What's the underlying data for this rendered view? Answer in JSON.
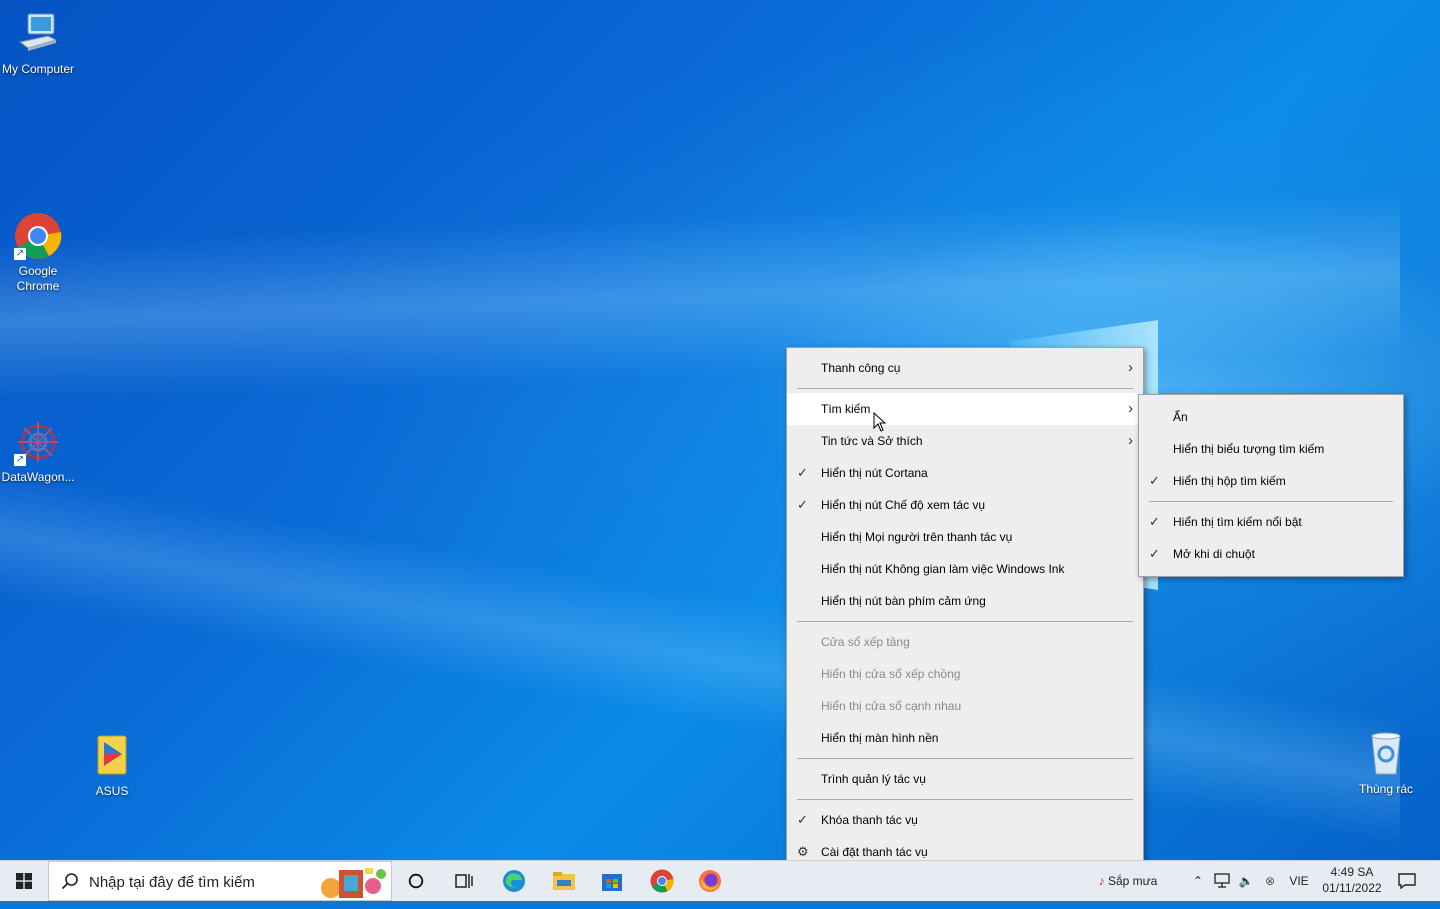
{
  "desktop": {
    "icons": [
      {
        "label": "My Computer",
        "icon": "computer-icon"
      },
      {
        "label": "Google Chrome",
        "icon": "chrome-icon"
      },
      {
        "label": "DataWagon...",
        "icon": "datawagon-icon"
      },
      {
        "label": "ASUS",
        "icon": "asus-folder-icon"
      },
      {
        "label": "Thùng rác",
        "icon": "recycle-bin-icon"
      }
    ]
  },
  "context_menu": {
    "items": [
      {
        "label": "Thanh công cụ",
        "submenu": true
      },
      {
        "label": "Tìm kiếm",
        "submenu": true,
        "highlighted": true
      },
      {
        "label": "Tin tức và Sở thích",
        "submenu": true
      },
      {
        "label": "Hiển thị nút Cortana",
        "checked": true
      },
      {
        "label": "Hiển thị nút Chế độ xem tác vụ",
        "checked": true
      },
      {
        "label": "Hiển thị Mọi người trên thanh tác vụ"
      },
      {
        "label": "Hiển thị nút Không gian làm việc Windows Ink"
      },
      {
        "label": "Hiển thị nút bàn phím cảm ứng"
      },
      {
        "label": "Cửa sổ xếp tầng",
        "disabled": true
      },
      {
        "label": "Hiển thị cửa sổ xếp chồng",
        "disabled": true
      },
      {
        "label": "Hiển thị cửa sổ cạnh nhau",
        "disabled": true
      },
      {
        "label": "Hiển thị màn hình nền"
      },
      {
        "label": "Trình quản lý tác vụ"
      },
      {
        "label": "Khóa thanh tác vụ",
        "checked": true
      },
      {
        "label": "Cài đặt thanh tác vụ",
        "icon": "gear-icon"
      }
    ]
  },
  "search_submenu": {
    "items": [
      {
        "label": "Ẩn"
      },
      {
        "label": "Hiển thị biểu tượng tìm kiếm"
      },
      {
        "label": "Hiển thị hộp tìm kiếm",
        "checked": true
      },
      {
        "label": "Hiển thị tìm kiếm nổi bật",
        "checked": true
      },
      {
        "label": "Mở khi di chuột",
        "checked": true
      }
    ]
  },
  "taskbar": {
    "search_placeholder": "Nhập tại đây để tìm kiếm",
    "weather_text": "Sắp mưa",
    "language": "VIE",
    "time": "4:49 SA",
    "date": "01/11/2022"
  },
  "colors": {
    "menu_bg": "#eeeeee",
    "menu_hover": "#ffffff",
    "taskbar_bg": "#e7ecf2",
    "accent": "#0a78d7"
  }
}
